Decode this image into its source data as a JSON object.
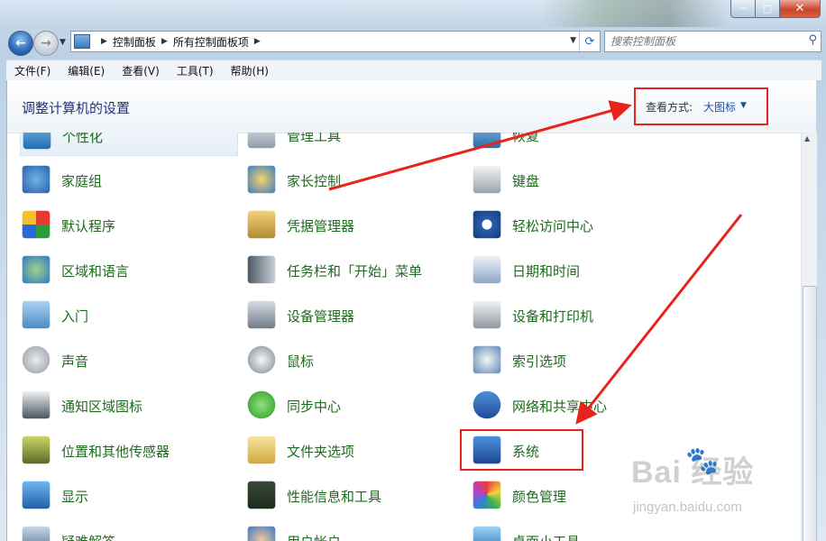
{
  "window": {
    "min": "─",
    "max": "□",
    "close": "✕"
  },
  "address": {
    "crumbs": [
      "控制面板",
      "所有控制面板项"
    ]
  },
  "search": {
    "placeholder": "搜索控制面板"
  },
  "menu": [
    "文件(F)",
    "编辑(E)",
    "查看(V)",
    "工具(T)",
    "帮助(H)"
  ],
  "header": {
    "title": "调整计算机的设置",
    "view_label": "查看方式:",
    "view_value": "大图标"
  },
  "items": [
    {
      "label": "个性化",
      "icon": "personalization-icon"
    },
    {
      "label": "管理工具",
      "icon": "admin-tools-icon"
    },
    {
      "label": "恢复",
      "icon": "recovery-icon"
    },
    {
      "label": "家庭组",
      "icon": "homegroup-icon"
    },
    {
      "label": "家长控制",
      "icon": "parental-controls-icon"
    },
    {
      "label": "键盘",
      "icon": "keyboard-icon"
    },
    {
      "label": "默认程序",
      "icon": "default-programs-icon"
    },
    {
      "label": "凭据管理器",
      "icon": "credential-manager-icon"
    },
    {
      "label": "轻松访问中心",
      "icon": "ease-of-access-icon"
    },
    {
      "label": "区域和语言",
      "icon": "region-language-icon"
    },
    {
      "label": "任务栏和「开始」菜单",
      "icon": "taskbar-icon"
    },
    {
      "label": "日期和时间",
      "icon": "date-time-icon"
    },
    {
      "label": "入门",
      "icon": "getting-started-icon"
    },
    {
      "label": "设备管理器",
      "icon": "device-manager-icon"
    },
    {
      "label": "设备和打印机",
      "icon": "devices-printers-icon"
    },
    {
      "label": "声音",
      "icon": "sound-icon"
    },
    {
      "label": "鼠标",
      "icon": "mouse-icon"
    },
    {
      "label": "索引选项",
      "icon": "indexing-options-icon"
    },
    {
      "label": "通知区域图标",
      "icon": "notification-area-icon"
    },
    {
      "label": "同步中心",
      "icon": "sync-center-icon"
    },
    {
      "label": "网络和共享中心",
      "icon": "network-center-icon"
    },
    {
      "label": "位置和其他传感器",
      "icon": "location-sensors-icon"
    },
    {
      "label": "文件夹选项",
      "icon": "folder-options-icon"
    },
    {
      "label": "系统",
      "icon": "system-icon"
    },
    {
      "label": "显示",
      "icon": "display-icon"
    },
    {
      "label": "性能信息和工具",
      "icon": "performance-icon"
    },
    {
      "label": "颜色管理",
      "icon": "color-management-icon"
    },
    {
      "label": "疑难解答",
      "icon": "troubleshooting-icon"
    },
    {
      "label": "用户帐户",
      "icon": "user-accounts-icon"
    },
    {
      "label": "桌面小工具",
      "icon": "gadgets-icon"
    }
  ],
  "watermark": {
    "brand": "Bai  经验",
    "url": "jingyan.baidu.com"
  },
  "colors": {
    "link_green": "#1e6a1e",
    "title_blue": "#1e3287",
    "annotation_red": "#e8231c"
  }
}
